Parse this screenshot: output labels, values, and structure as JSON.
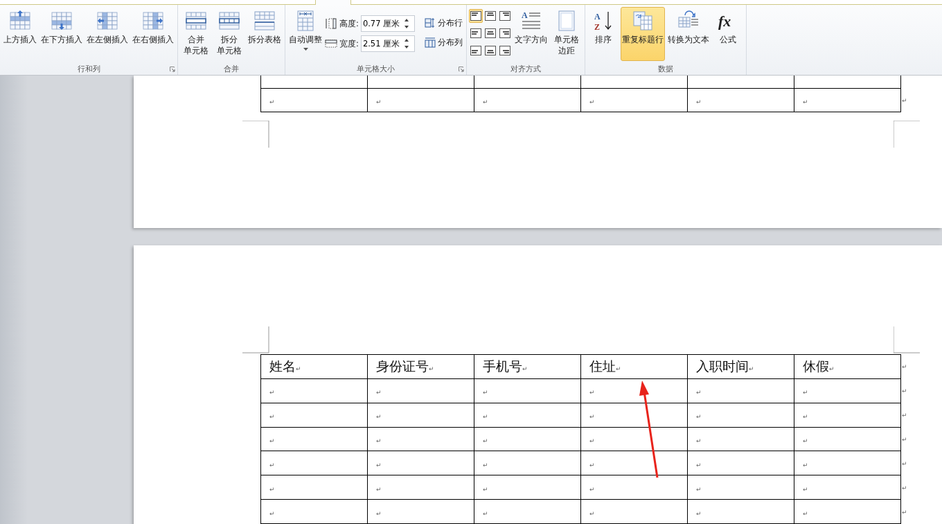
{
  "ribbon": {
    "groups": [
      {
        "label": "行和列",
        "launcher": true,
        "items": [
          {
            "kind": "large",
            "lines": [
              "上方插入"
            ],
            "selected": false
          },
          {
            "kind": "large",
            "lines": [
              "在下方插入"
            ],
            "selected": false
          },
          {
            "kind": "large",
            "lines": [
              "在左侧插入"
            ],
            "selected": false
          },
          {
            "kind": "large",
            "lines": [
              "在右侧插入"
            ],
            "selected": false
          }
        ]
      },
      {
        "label": "合并",
        "launcher": false,
        "items": [
          {
            "kind": "large",
            "lines": [
              "合并",
              "单元格"
            ],
            "selected": false
          },
          {
            "kind": "large",
            "lines": [
              "拆分",
              "单元格"
            ],
            "selected": false
          },
          {
            "kind": "large",
            "lines": [
              "拆分表格"
            ],
            "selected": false
          }
        ]
      },
      {
        "label": "单元格大小",
        "launcher": true,
        "items": [
          {
            "kind": "large",
            "lines": [
              "自动调整"
            ],
            "selected": false,
            "dropdown": true
          },
          {
            "kind": "spinners",
            "fields": [
              {
                "label": "高度:",
                "value": "0.77 厘米"
              },
              {
                "label": "宽度:",
                "value": "2.51 厘米"
              }
            ]
          },
          {
            "kind": "small_stack",
            "buttons": [
              {
                "label": "分布行"
              },
              {
                "label": "分布列"
              }
            ]
          }
        ]
      },
      {
        "label": "对齐方式",
        "launcher": false,
        "items": [
          {
            "kind": "align_grid",
            "cells": [
              {
                "selected": true
              },
              {
                "selected": false
              },
              {
                "selected": false
              },
              {
                "selected": false
              },
              {
                "selected": false
              },
              {
                "selected": false
              },
              {
                "selected": false
              },
              {
                "selected": false
              },
              {
                "selected": false
              }
            ]
          },
          {
            "kind": "large",
            "lines": [
              "文字方向"
            ],
            "glyphs": [
              "A"
            ],
            "selected": false
          },
          {
            "kind": "large",
            "lines": [
              "单元格",
              "边距"
            ],
            "selected": false
          }
        ]
      },
      {
        "label": "数据",
        "launcher": false,
        "items": [
          {
            "kind": "large",
            "lines": [
              "排序"
            ],
            "glyphs": [
              "A",
              "Z"
            ],
            "selected": false
          },
          {
            "kind": "large",
            "lines": [
              "重复标题行"
            ],
            "selected": true
          },
          {
            "kind": "large",
            "lines": [
              "转换为文本"
            ],
            "selected": false
          },
          {
            "kind": "large",
            "lines": [
              "公式"
            ],
            "glyphs": [
              "fx"
            ],
            "selected": false
          }
        ]
      }
    ]
  },
  "pages": [
    {
      "table": {
        "rows": [
          {
            "cells": [
              "↵",
              "↵",
              "↵",
              "↵",
              "↵",
              "↵"
            ],
            "end": "↵"
          }
        ]
      }
    },
    {
      "table": {
        "header": {
          "cells": [
            {
              "text": "姓名",
              "mark": "↵"
            },
            {
              "text": "身份证号",
              "mark": "↵"
            },
            {
              "text": "手机号",
              "mark": "↵"
            },
            {
              "text": "住址",
              "mark": "↵"
            },
            {
              "text": "入职时间",
              "mark": "↵"
            },
            {
              "text": "休假",
              "mark": "↵"
            }
          ],
          "end": "↵"
        },
        "rows": [
          {
            "cells": [
              "↵",
              "↵",
              "↵",
              "↵",
              "↵",
              "↵"
            ],
            "end": "↵"
          },
          {
            "cells": [
              "↵",
              "↵",
              "↵",
              "↵",
              "↵",
              "↵"
            ],
            "end": "↵"
          },
          {
            "cells": [
              "↵",
              "↵",
              "↵",
              "↵",
              "↵",
              "↵"
            ],
            "end": "↵"
          },
          {
            "cells": [
              "↵",
              "↵",
              "↵",
              "↵",
              "↵",
              "↵"
            ],
            "end": "↵"
          },
          {
            "cells": [
              "↵",
              "↵",
              "↵",
              "↵",
              "↵",
              "↵"
            ],
            "end": "↵"
          },
          {
            "cells": [
              "↵",
              "↵",
              "↵",
              "↵",
              "↵",
              "↵"
            ],
            "end": "↵"
          }
        ]
      }
    }
  ]
}
